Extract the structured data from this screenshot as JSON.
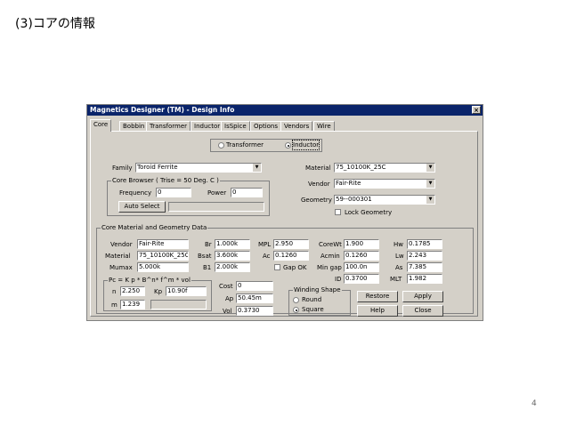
{
  "slide": {
    "title": "(3)コアの情報",
    "page_number": "4"
  },
  "window": {
    "title": "Magnetics Designer (TM) - Design Info",
    "close_glyph": "×"
  },
  "tabs": [
    "Core",
    "Bobbin",
    "Transformer",
    "Inductor",
    "IsSpice",
    "Options",
    "Vendors",
    "Wire"
  ],
  "mode": {
    "transformer": "Transformer",
    "inductor": "Inductor",
    "selected": "inductor"
  },
  "top": {
    "family_label": "Family",
    "family_value": "Toroid Ferrite",
    "material_label": "Material",
    "material_value": "75_10100K_25C",
    "vendor_label": "Vendor",
    "vendor_value": "Fair-Rite",
    "geometry_label": "Geometry",
    "geometry_value": "59--000301",
    "lock_geometry": "Lock Geometry"
  },
  "core_browser": {
    "title": "Core Browser  ( Trise = 50 Deg. C )",
    "frequency_label": "Frequency",
    "frequency_value": "0",
    "power_label": "Power",
    "power_value": "0",
    "auto_select": "Auto Select"
  },
  "core_data": {
    "title": "Core Material and Geometry Data",
    "vendor_label": "Vendor",
    "vendor_value": "Fair-Rite",
    "material_label": "Material",
    "material_value": "75_10100K_25C",
    "mumax_label": "Mumax",
    "mumax_value": "5.000k",
    "br_label": "Br",
    "br_value": "1.000k",
    "bsat_label": "Bsat",
    "bsat_value": "3.600k",
    "b1_label": "B1",
    "b1_value": "2.000k",
    "mpl_label": "MPL",
    "mpl_value": "2.950",
    "ac_label": "Ac",
    "ac_value": "0.1260",
    "gap_ok": "Gap OK",
    "corewt_label": "CoreWt",
    "corewt_value": "1.900",
    "acmin_label": "Acmin",
    "acmin_value": "0.1260",
    "mingap_label": "Min gap",
    "mingap_value": "100.0n",
    "id_label": "ID",
    "id_value": "0.3700",
    "hw_label": "Hw",
    "hw_value": "0.1785",
    "lw_label": "Lw",
    "lw_value": "2.243",
    "as_label": "As",
    "as_value": "7.385",
    "mlt_label": "MLT",
    "mlt_value": "1.982"
  },
  "pc": {
    "title": "Pc = K p * B^n* f^m * vol",
    "n_label": "n",
    "n_value": "2.250",
    "kp_label": "Kp",
    "kp_value": "10.90f",
    "m_label": "m",
    "m_value": "1.239"
  },
  "cost": {
    "cost_label": "Cost",
    "cost_value": "0",
    "ap_label": "Ap",
    "ap_value": "50.45m",
    "vol_label": "Vol",
    "vol_value": "0.3730"
  },
  "winding_shape": {
    "title": "Winding Shape",
    "round": "Round",
    "square": "Square",
    "selected": "square"
  },
  "buttons": {
    "restore": "Restore",
    "apply": "Apply",
    "help": "Help",
    "close": "Close"
  },
  "icons": {
    "combo_arrow": "▼"
  }
}
